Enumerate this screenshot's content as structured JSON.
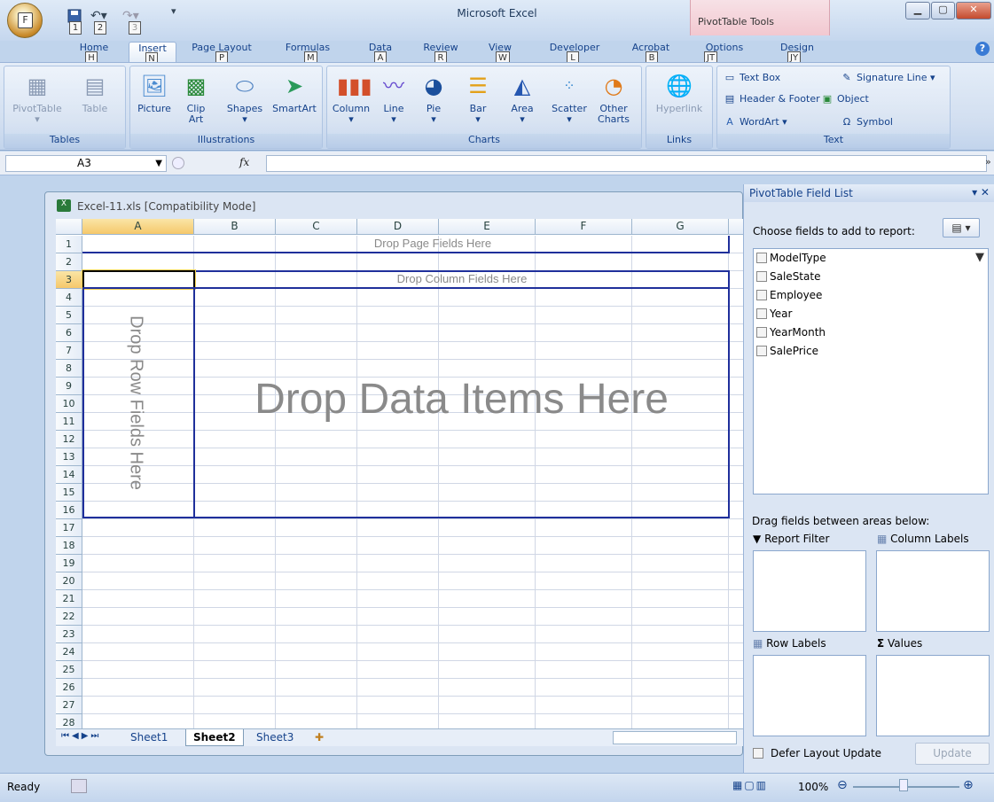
{
  "app_title": "Microsoft Excel",
  "context_tab_group": "PivotTable Tools",
  "office_button": {
    "keytip": "F"
  },
  "qat_keytips": [
    "1",
    "2",
    "3"
  ],
  "tabs": [
    {
      "label": "Home",
      "keytip": "H"
    },
    {
      "label": "Insert",
      "keytip": "N",
      "active": true
    },
    {
      "label": "Page Layout",
      "keytip": "P"
    },
    {
      "label": "Formulas",
      "keytip": "M"
    },
    {
      "label": "Data",
      "keytip": "A"
    },
    {
      "label": "Review",
      "keytip": "R"
    },
    {
      "label": "View",
      "keytip": "W"
    },
    {
      "label": "Developer",
      "keytip": "L"
    },
    {
      "label": "Acrobat",
      "keytip": "B"
    },
    {
      "label": "Options",
      "keytip": "JT"
    },
    {
      "label": "Design",
      "keytip": "JY"
    }
  ],
  "ribbon": {
    "tables": {
      "label": "Tables",
      "pivottable": "PivotTable",
      "table": "Table"
    },
    "illustrations": {
      "label": "Illustrations",
      "picture": "Picture",
      "clip_art": "Clip Art",
      "shapes": "Shapes",
      "smartart": "SmartArt"
    },
    "charts": {
      "label": "Charts",
      "column": "Column",
      "line": "Line",
      "pie": "Pie",
      "bar": "Bar",
      "area": "Area",
      "scatter": "Scatter",
      "other": "Other Charts"
    },
    "links": {
      "label": "Links",
      "hyperlink": "Hyperlink"
    },
    "text": {
      "label": "Text",
      "text_box": "Text Box",
      "header_footer": "Header & Footer",
      "wordart": "WordArt",
      "signature_line": "Signature Line",
      "object": "Object",
      "symbol": "Symbol"
    }
  },
  "formula_bar": {
    "name_box": "A3",
    "fx": "fx",
    "value": ""
  },
  "workbook": {
    "title": "Excel-11.xls  [Compatibility Mode]",
    "columns": [
      "A",
      "B",
      "C",
      "D",
      "E",
      "F",
      "G"
    ],
    "rows": [
      "1",
      "2",
      "3",
      "4",
      "5",
      "6",
      "7",
      "8",
      "9",
      "10",
      "11",
      "12",
      "13",
      "14",
      "15",
      "16",
      "17",
      "18",
      "19",
      "20",
      "21",
      "22",
      "23",
      "24",
      "25",
      "26",
      "27",
      "28"
    ],
    "drop_page": "Drop Page Fields Here",
    "drop_column": "Drop Column Fields Here",
    "drop_row": "Drop Row Fields Here",
    "drop_data": "Drop Data Items Here",
    "sheets": [
      "Sheet1",
      "Sheet2",
      "Sheet3"
    ],
    "active_sheet": "Sheet2"
  },
  "field_list": {
    "title": "PivotTable Field List",
    "choose_label": "Choose fields to add to report:",
    "fields": [
      "ModelType",
      "SaleState",
      "Employee",
      "Year",
      "YearMonth",
      "SalePrice"
    ],
    "drag_label": "Drag fields between areas below:",
    "areas": {
      "report_filter": "Report Filter",
      "column_labels": "Column Labels",
      "row_labels": "Row Labels",
      "values": "Values"
    },
    "defer_label": "Defer Layout Update",
    "update_button": "Update"
  },
  "status": {
    "ready": "Ready",
    "zoom": "100%"
  }
}
